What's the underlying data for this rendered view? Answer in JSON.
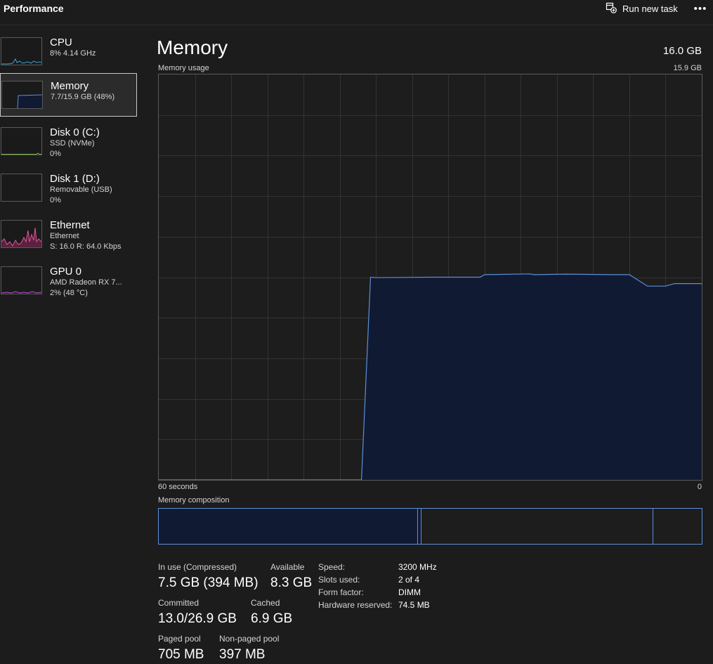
{
  "header": {
    "title": "Performance",
    "run_new_task": "Run new task",
    "more": "•••"
  },
  "sidebar": {
    "items": [
      {
        "title": "CPU",
        "sub1": "8%  4.14 GHz",
        "sub2": "",
        "sub3": "",
        "graph_color": "#3aa0d6"
      },
      {
        "title": "Memory",
        "sub1": "7.7/15.9 GB (48%)",
        "sub2": "",
        "sub3": "",
        "graph_color": "#5b8fd8"
      },
      {
        "title": "Disk 0 (C:)",
        "sub1": "SSD (NVMe)",
        "sub2": "0%",
        "sub3": "",
        "graph_color": "#7cb342"
      },
      {
        "title": "Disk 1 (D:)",
        "sub1": "Removable (USB)",
        "sub2": "0%",
        "sub3": "",
        "graph_color": "#7cb342"
      },
      {
        "title": "Ethernet",
        "sub1": "Ethernet",
        "sub2": "S: 16.0  R: 64.0 Kbps",
        "sub3": "",
        "graph_color": "#e0569a"
      },
      {
        "title": "GPU 0",
        "sub1": "AMD Radeon RX 7...",
        "sub2": "2% (48 °C)",
        "sub3": "",
        "graph_color": "#c056d8"
      }
    ]
  },
  "main": {
    "title": "Memory",
    "total": "16.0 GB",
    "usage_label": "Memory usage",
    "usage_max": "15.9 GB",
    "x_left": "60 seconds",
    "x_right": "0",
    "composition_label": "Memory composition"
  },
  "chart_data": {
    "type": "area",
    "title": "Memory usage",
    "xlabel": "",
    "ylabel": "",
    "x_range": [
      60,
      0
    ],
    "ylim": [
      0,
      15.9
    ],
    "grid": true,
    "series": [
      {
        "name": "",
        "color": "#5b8fd8",
        "fill": "#111a33",
        "x": [
          60,
          37.6,
          36.6,
          36,
          30,
          24.5,
          24,
          19,
          18.5,
          15,
          10,
          8,
          6,
          4,
          3,
          0
        ],
        "y": [
          0,
          0,
          7.95,
          7.93,
          7.95,
          7.95,
          8.05,
          8.08,
          8.05,
          8.07,
          8.05,
          8.05,
          7.6,
          7.6,
          7.7,
          7.7
        ]
      }
    ]
  },
  "stats": {
    "in_use_label": "In use (Compressed)",
    "in_use_value": "7.5 GB (394 MB)",
    "available_label": "Available",
    "available_value": "8.3 GB",
    "committed_label": "Committed",
    "committed_value": "13.0/26.9 GB",
    "cached_label": "Cached",
    "cached_value": "6.9 GB",
    "paged_label": "Paged pool",
    "paged_value": "705 MB",
    "nonpaged_label": "Non-paged pool",
    "nonpaged_value": "397 MB"
  },
  "specs": {
    "speed_label": "Speed:",
    "speed_value": "3200 MHz",
    "slots_label": "Slots used:",
    "slots_value": "2 of 4",
    "form_label": "Form factor:",
    "form_value": "DIMM",
    "reserved_label": "Hardware reserved:",
    "reserved_value": "74.5 MB"
  }
}
